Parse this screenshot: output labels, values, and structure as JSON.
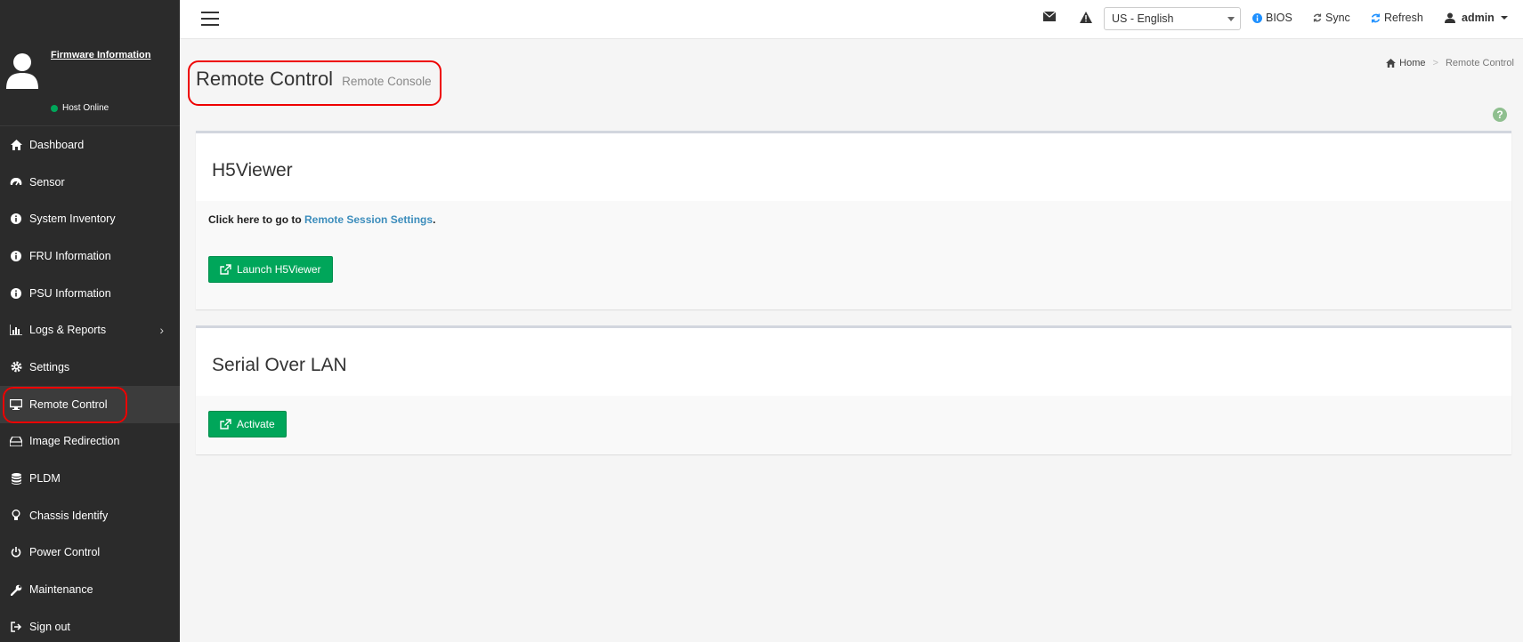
{
  "sidebar": {
    "firmware_link": "Firmware Information",
    "host_status": "Host Online",
    "items": [
      {
        "label": "Dashboard"
      },
      {
        "label": "Sensor"
      },
      {
        "label": "System Inventory"
      },
      {
        "label": "FRU Information"
      },
      {
        "label": "PSU Information"
      },
      {
        "label": "Logs & Reports",
        "has_submenu": true
      },
      {
        "label": "Settings"
      },
      {
        "label": "Remote Control",
        "active": true
      },
      {
        "label": "Image Redirection"
      },
      {
        "label": "PLDM"
      },
      {
        "label": "Chassis Identify"
      },
      {
        "label": "Power Control"
      },
      {
        "label": "Maintenance"
      },
      {
        "label": "Sign out"
      }
    ]
  },
  "topbar": {
    "language": "US - English",
    "bios_label": "BIOS",
    "sync_label": "Sync",
    "refresh_label": "Refresh",
    "user_label": "admin"
  },
  "page": {
    "title": "Remote Control",
    "subtitle": "Remote Console",
    "breadcrumb_home": "Home",
    "breadcrumb_current": "Remote Control"
  },
  "h5viewer": {
    "heading": "H5Viewer",
    "text_prefix": "Click here to go to ",
    "link_text": "Remote Session Settings",
    "text_suffix": ".",
    "button_label": "Launch H5Viewer"
  },
  "sol": {
    "heading": "Serial Over LAN",
    "button_label": "Activate"
  },
  "colors": {
    "sidebar_bg": "#2b2b2b",
    "accent_green": "#00a65a",
    "link_blue": "#3c8dbc",
    "highlight_red": "#e00000"
  }
}
